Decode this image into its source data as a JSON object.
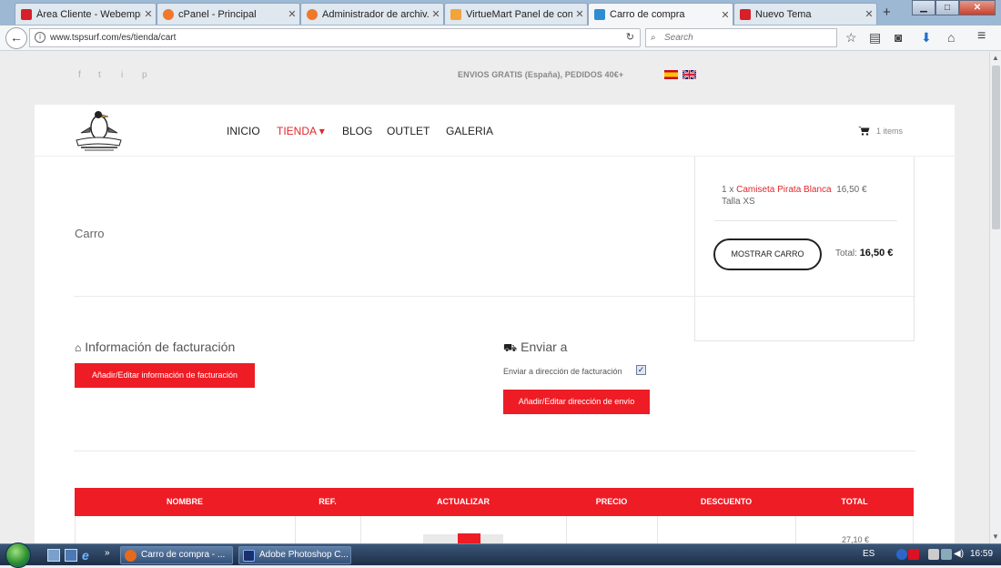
{
  "browser": {
    "tabs": [
      {
        "title": "Área Cliente - Webempr...",
        "favicon_color": "#d6202a",
        "active": false
      },
      {
        "title": "cPanel - Principal",
        "favicon_color": "#f0782a",
        "active": false
      },
      {
        "title": "Administrador de archiv...",
        "favicon_color": "#f0782a",
        "active": false
      },
      {
        "title": "VirtueMart Panel de con...",
        "favicon_color": "#f2a33a",
        "active": false
      },
      {
        "title": "Carro de compra",
        "favicon_color": "#2d8dd2",
        "active": true
      },
      {
        "title": "Nuevo Tema",
        "favicon_color": "#d6202a",
        "active": false
      }
    ],
    "new_tab_label": "+",
    "url": "www.tspsurf.com/es/tienda/cart",
    "search_placeholder": "Search",
    "toolbar_icons": [
      "star-icon",
      "reading-list-icon",
      "pocket-icon",
      "download-icon",
      "home-icon",
      "menu-icon"
    ]
  },
  "site": {
    "shipping_banner": "ENVIOS GRATIS (España), PEDIDOS 40€+",
    "social": [
      "f",
      "t",
      "i",
      "p"
    ],
    "flags": [
      "es",
      "en"
    ],
    "nav": [
      {
        "label": "INICIO",
        "active": false
      },
      {
        "label": "TIENDA",
        "active": true,
        "caret": "▾"
      },
      {
        "label": "BLOG",
        "active": false
      },
      {
        "label": "OUTLET",
        "active": false
      },
      {
        "label": "GALERIA",
        "active": false
      }
    ],
    "cart_count": "1 items"
  },
  "minicart": {
    "qty": "1 x",
    "product": "Camiseta Pirata Blanca",
    "price": "16,50 €",
    "size": "Talla XS",
    "button": "MOSTRAR CARRO",
    "total_label": "Total:",
    "total_value": "16,50 €"
  },
  "page": {
    "title": "Carro",
    "billing": {
      "heading": "Información de facturación",
      "button": "Añadir/Editar información de facturación"
    },
    "shipping": {
      "heading": "Enviar a",
      "checkbox_label": "Enviar a dirección de facturación",
      "checked": true,
      "button": "Añadir/Editar dirección de envío"
    },
    "table": {
      "headers": [
        "NOMBRE",
        "REF.",
        "ACTUALIZAR",
        "PRECIO",
        "DESCUENTO",
        "TOTAL"
      ],
      "row_total_partial": "27,10 €"
    }
  },
  "taskbar": {
    "buttons": [
      {
        "label": "Carro de compra - ...",
        "icon_color": "#e66a1e"
      },
      {
        "label": "Adobe Photoshop C...",
        "icon_color": "#1b2f6b"
      }
    ],
    "language": "ES",
    "time": "16:59"
  },
  "colors": {
    "accent_red": "#ee1c25",
    "nav_active": "#e0272c"
  }
}
